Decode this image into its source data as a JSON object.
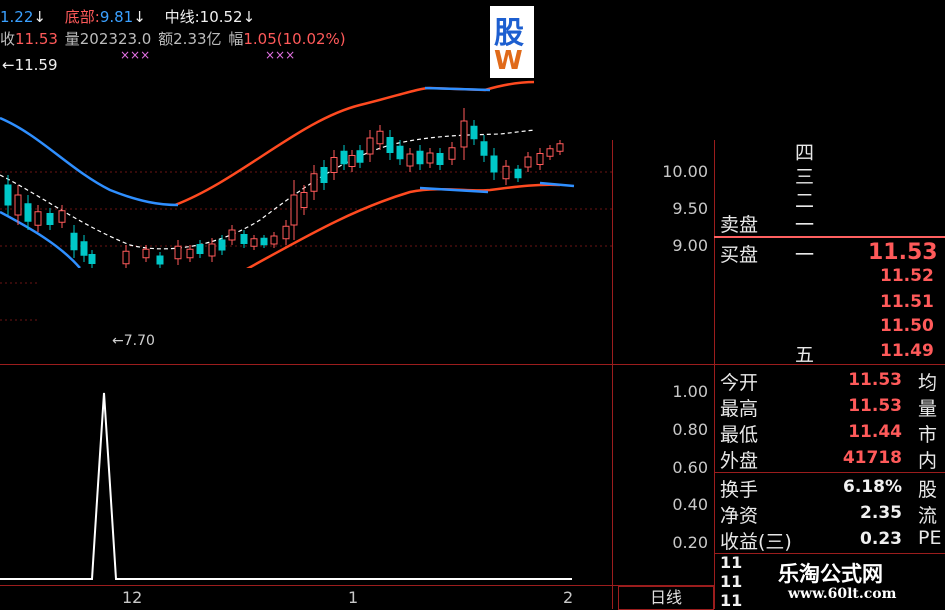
{
  "header": {
    "row1": {
      "first_value": "1.22",
      "bottom_label": "底部:",
      "bottom_value": "9.81",
      "mid_label": "中线:",
      "mid_value": "10.52",
      "arrow": "↓"
    },
    "row2": {
      "price_prefix": "收",
      "price": "11.53",
      "volume_label": "量",
      "volume": "202323.0",
      "amount_label": "额",
      "amount": "2.33亿",
      "change_label": "幅",
      "change": "1.05(10.02%)"
    },
    "row3_marker": "←11.59",
    "low_marker": "←7.70",
    "pink_marks": "×××"
  },
  "logo": {
    "text_top": "股",
    "text_bottom": "W"
  },
  "main_chart": {
    "y_ticks": [
      "10.00",
      "9.50",
      "9.00"
    ],
    "x_labels": [
      "12",
      "1",
      "2"
    ]
  },
  "indicator_chart": {
    "y_ticks": [
      "1.00",
      "0.80",
      "0.60",
      "0.40",
      "0.20"
    ],
    "period_label": "日线"
  },
  "order_book": {
    "sell_levels": [
      "四",
      "三",
      "二",
      "一"
    ],
    "sell_label": "卖盘",
    "buy_label": "买盘",
    "buy_levels": [
      "一",
      "五"
    ],
    "buy_prices": [
      "11.53",
      "11.52",
      "11.51",
      "11.50",
      "11.49"
    ]
  },
  "stats": [
    {
      "label": "今开",
      "value": "11.53",
      "right": "均"
    },
    {
      "label": "最高",
      "value": "11.53",
      "right": "量"
    },
    {
      "label": "最低",
      "value": "11.44",
      "right": "市"
    },
    {
      "label": "外盘",
      "value": "41718",
      "right": "内"
    },
    {
      "label": "换手",
      "value": "6.18%",
      "right": "股"
    },
    {
      "label": "净资",
      "value": "2.35",
      "right": "流"
    },
    {
      "label": "收益(三)",
      "value": "0.23",
      "right": "PE"
    }
  ],
  "bottom_rows": [
    "11",
    "11",
    "11"
  ],
  "watermark": {
    "title": "乐淘公式网",
    "url": "www.60lt.com"
  },
  "colors": {
    "background": "#000000",
    "up": "#ff5a5a",
    "down": "#00c8c8",
    "band_upper": "#ff4a20",
    "band_lower": "#2f8fff",
    "ma": "#ffffff",
    "grid": "#9b1d1d"
  }
}
